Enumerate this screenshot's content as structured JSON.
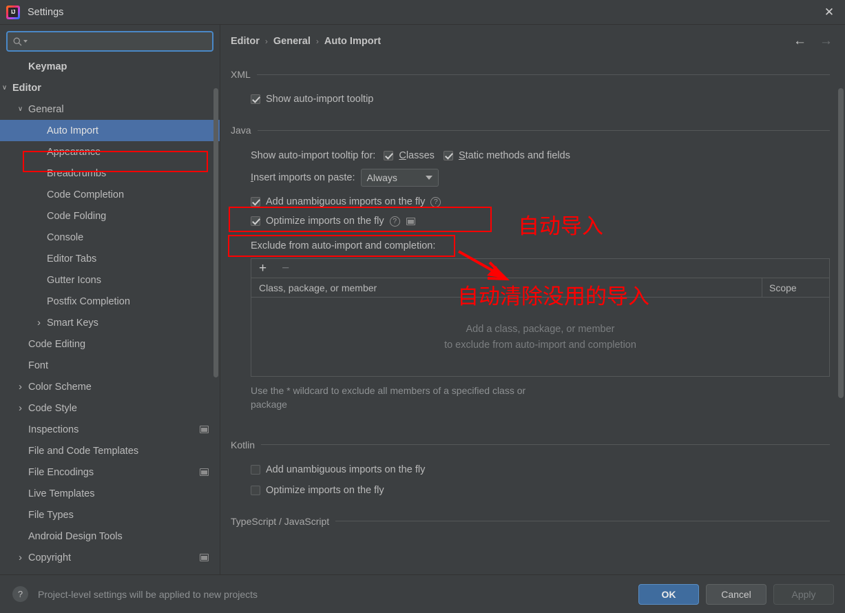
{
  "window": {
    "title": "Settings",
    "logo_text": "IJ",
    "logo_icon": "intellij-idea-logo",
    "close_icon": "close-icon"
  },
  "search": {
    "value": "",
    "placeholder": "",
    "icon": "search-icon"
  },
  "sidebar": {
    "items": [
      {
        "label": "Keymap",
        "indent": 1,
        "arrow": "",
        "bold": true,
        "selected": false,
        "project_icon": false
      },
      {
        "label": "Editor",
        "indent": 0,
        "arrow": "v",
        "bold": true,
        "selected": false,
        "project_icon": false
      },
      {
        "label": "General",
        "indent": 1,
        "arrow": "v",
        "bold": false,
        "selected": false,
        "project_icon": false
      },
      {
        "label": "Auto Import",
        "indent": 2,
        "arrow": "",
        "bold": false,
        "selected": true,
        "project_icon": false
      },
      {
        "label": "Appearance",
        "indent": 2,
        "arrow": "",
        "bold": false,
        "selected": false,
        "project_icon": false
      },
      {
        "label": "Breadcrumbs",
        "indent": 2,
        "arrow": "",
        "bold": false,
        "selected": false,
        "project_icon": false
      },
      {
        "label": "Code Completion",
        "indent": 2,
        "arrow": "",
        "bold": false,
        "selected": false,
        "project_icon": false
      },
      {
        "label": "Code Folding",
        "indent": 2,
        "arrow": "",
        "bold": false,
        "selected": false,
        "project_icon": false
      },
      {
        "label": "Console",
        "indent": 2,
        "arrow": "",
        "bold": false,
        "selected": false,
        "project_icon": false
      },
      {
        "label": "Editor Tabs",
        "indent": 2,
        "arrow": "",
        "bold": false,
        "selected": false,
        "project_icon": false
      },
      {
        "label": "Gutter Icons",
        "indent": 2,
        "arrow": "",
        "bold": false,
        "selected": false,
        "project_icon": false
      },
      {
        "label": "Postfix Completion",
        "indent": 2,
        "arrow": "",
        "bold": false,
        "selected": false,
        "project_icon": false
      },
      {
        "label": "Smart Keys",
        "indent": 2,
        "arrow": ">",
        "bold": false,
        "selected": false,
        "project_icon": false
      },
      {
        "label": "Code Editing",
        "indent": 1,
        "arrow": "",
        "bold": false,
        "selected": false,
        "project_icon": false
      },
      {
        "label": "Font",
        "indent": 1,
        "arrow": "",
        "bold": false,
        "selected": false,
        "project_icon": false
      },
      {
        "label": "Color Scheme",
        "indent": 1,
        "arrow": ">",
        "bold": false,
        "selected": false,
        "project_icon": false
      },
      {
        "label": "Code Style",
        "indent": 1,
        "arrow": ">",
        "bold": false,
        "selected": false,
        "project_icon": false
      },
      {
        "label": "Inspections",
        "indent": 1,
        "arrow": "",
        "bold": false,
        "selected": false,
        "project_icon": true
      },
      {
        "label": "File and Code Templates",
        "indent": 1,
        "arrow": "",
        "bold": false,
        "selected": false,
        "project_icon": false
      },
      {
        "label": "File Encodings",
        "indent": 1,
        "arrow": "",
        "bold": false,
        "selected": false,
        "project_icon": true
      },
      {
        "label": "Live Templates",
        "indent": 1,
        "arrow": "",
        "bold": false,
        "selected": false,
        "project_icon": false
      },
      {
        "label": "File Types",
        "indent": 1,
        "arrow": "",
        "bold": false,
        "selected": false,
        "project_icon": false
      },
      {
        "label": "Android Design Tools",
        "indent": 1,
        "arrow": "",
        "bold": false,
        "selected": false,
        "project_icon": false
      },
      {
        "label": "Copyright",
        "indent": 1,
        "arrow": ">",
        "bold": false,
        "selected": false,
        "project_icon": true
      }
    ]
  },
  "breadcrumb": {
    "items": [
      "Editor",
      "General",
      "Auto Import"
    ],
    "separator": "›",
    "back_icon": "arrow-left-icon",
    "forward_icon": "arrow-right-icon"
  },
  "main": {
    "xml": {
      "title": "XML",
      "show_tooltip_label": "Show auto-import tooltip",
      "show_tooltip_checked": true
    },
    "java": {
      "title": "Java",
      "tooltip_for_label": "Show auto-import tooltip for:",
      "classes_label": "Classes",
      "classes_mnemonic": "C",
      "classes_checked": true,
      "static_label": "Static methods and fields",
      "static_mnemonic": "S",
      "static_checked": true,
      "insert_label": "Insert imports on paste:",
      "insert_mnemonic": "I",
      "insert_value": "Always",
      "add_unambiguous_label": "Add unambiguous imports on the fly",
      "add_unambiguous_checked": true,
      "optimize_label": "Optimize imports on the fly",
      "optimize_checked": true,
      "exclude_label": "Exclude from auto-import and completion:",
      "table": {
        "add_button": "+",
        "remove_button": "−",
        "columns": [
          "Class, package, or member",
          "Scope"
        ],
        "rows": [],
        "empty_line1": "Add a class, package, or member",
        "empty_line2": "to exclude from auto-import and completion"
      },
      "hint_line1": "Use the * wildcard to exclude all members of a specified class or",
      "hint_line2": "package"
    },
    "kotlin": {
      "title": "Kotlin",
      "add_unambiguous_label": "Add unambiguous imports on the fly",
      "add_unambiguous_checked": false,
      "optimize_label": "Optimize imports on the fly",
      "optimize_checked": false
    },
    "typescript": {
      "title": "TypeScript / JavaScript"
    }
  },
  "annotations": {
    "color": "#ff0000",
    "auto_import_text": "自动导入",
    "clear_unused_text": "自动清除没用的导入"
  },
  "footer": {
    "help_icon": "help-icon",
    "note": "Project-level settings will be applied to new projects",
    "ok_label": "OK",
    "cancel_label": "Cancel",
    "apply_label": "Apply"
  }
}
